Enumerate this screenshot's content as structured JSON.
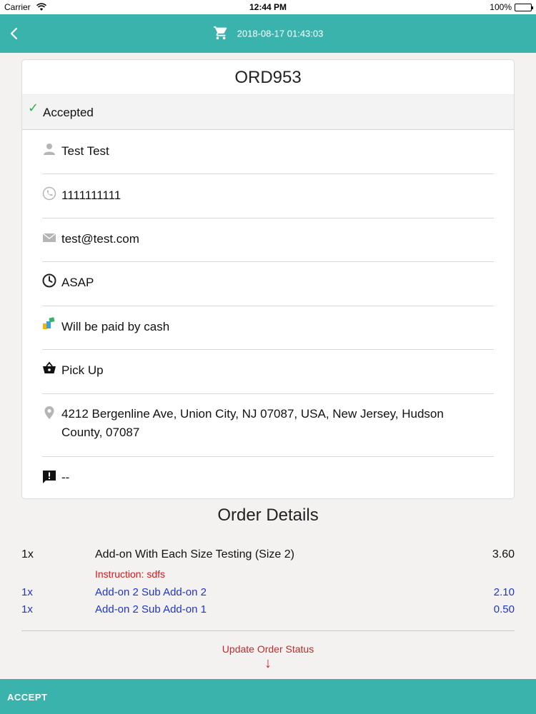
{
  "status_bar": {
    "carrier": "Carrier",
    "time": "12:44 PM",
    "battery": "100%"
  },
  "nav": {
    "back_icon": "chevron-left-icon",
    "cart_icon": "cart-icon",
    "datetime": "2018-08-17 01:43:03"
  },
  "order": {
    "id": "ORD953",
    "status": "Accepted",
    "status_icon": "check-icon",
    "info": [
      {
        "icon": "person-icon",
        "text": "Test Test"
      },
      {
        "icon": "phone-icon",
        "text": "1111111111"
      },
      {
        "icon": "email-icon",
        "text": "test@test.com"
      },
      {
        "icon": "clock-icon",
        "text": "ASAP"
      },
      {
        "icon": "cash-icon",
        "text": "Will be paid by cash"
      },
      {
        "icon": "basket-icon",
        "text": "Pick Up"
      },
      {
        "icon": "location-pin-icon",
        "text": "4212 Bergenline Ave, Union City, NJ 07087, USA, New Jersey, Hudson County, 07087"
      },
      {
        "icon": "alert-message-icon",
        "text": "--"
      }
    ]
  },
  "order_details": {
    "title": "Order Details",
    "items": [
      {
        "qty": "1x",
        "name": "Add-on With Each Size Testing (Size 2)",
        "price": "3.60",
        "instruction": "Instruction: sdfs"
      }
    ],
    "sub_items": [
      {
        "qty": "1x",
        "name": "Add-on 2 Sub Add-on 2",
        "price": "2.10"
      },
      {
        "qty": "1x",
        "name": "Add-on 2 Sub Add-on 1",
        "price": "0.50"
      }
    ]
  },
  "update_status": {
    "label": "Update Order Status",
    "arrow": "↓"
  },
  "accept": {
    "label": "ACCEPT"
  },
  "colors": {
    "primary": "#3bb3ad",
    "accepted": "#2bb24c",
    "instruction": "#d8191b",
    "sub_item": "#1f36c7",
    "update_status": "#c22a25"
  }
}
